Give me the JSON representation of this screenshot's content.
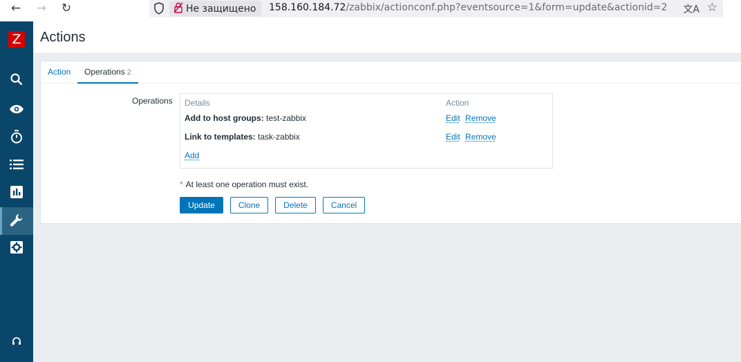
{
  "browser": {
    "insecure_label": "Не защищено",
    "url_host": "158.160.184.72",
    "url_path": "/zabbix/actionconf.php?eventsource=1&form=update&actionid=2"
  },
  "sidebar": {
    "logo": "Z",
    "items": [
      {
        "icon": "search-icon"
      },
      {
        "icon": "eye-icon"
      },
      {
        "icon": "stopwatch-icon"
      },
      {
        "icon": "list-icon"
      },
      {
        "icon": "bar-chart-icon"
      },
      {
        "icon": "wrench-icon",
        "active": true
      },
      {
        "icon": "gear-icon"
      },
      {
        "icon": "headset-icon"
      }
    ]
  },
  "page": {
    "title": "Actions"
  },
  "tabs": [
    {
      "label": "Action"
    },
    {
      "label": "Operations",
      "count": "2"
    }
  ],
  "form": {
    "operations_label": "Operations",
    "table": {
      "col_details": "Details",
      "col_action": "Action",
      "rows": [
        {
          "label": "Add to host groups:",
          "value": "test-zabbix",
          "edit": "Edit",
          "remove": "Remove"
        },
        {
          "label": "Link to templates:",
          "value": "task-zabbix",
          "edit": "Edit",
          "remove": "Remove"
        }
      ],
      "add_link": "Add"
    },
    "required_mark": "*",
    "warning": "At least one operation must exist."
  },
  "buttons": {
    "update": "Update",
    "clone": "Clone",
    "delete": "Delete",
    "cancel": "Cancel"
  },
  "colors": {
    "sidebar": "#0a466a",
    "accent": "#0275b8",
    "logo": "#d40000"
  }
}
